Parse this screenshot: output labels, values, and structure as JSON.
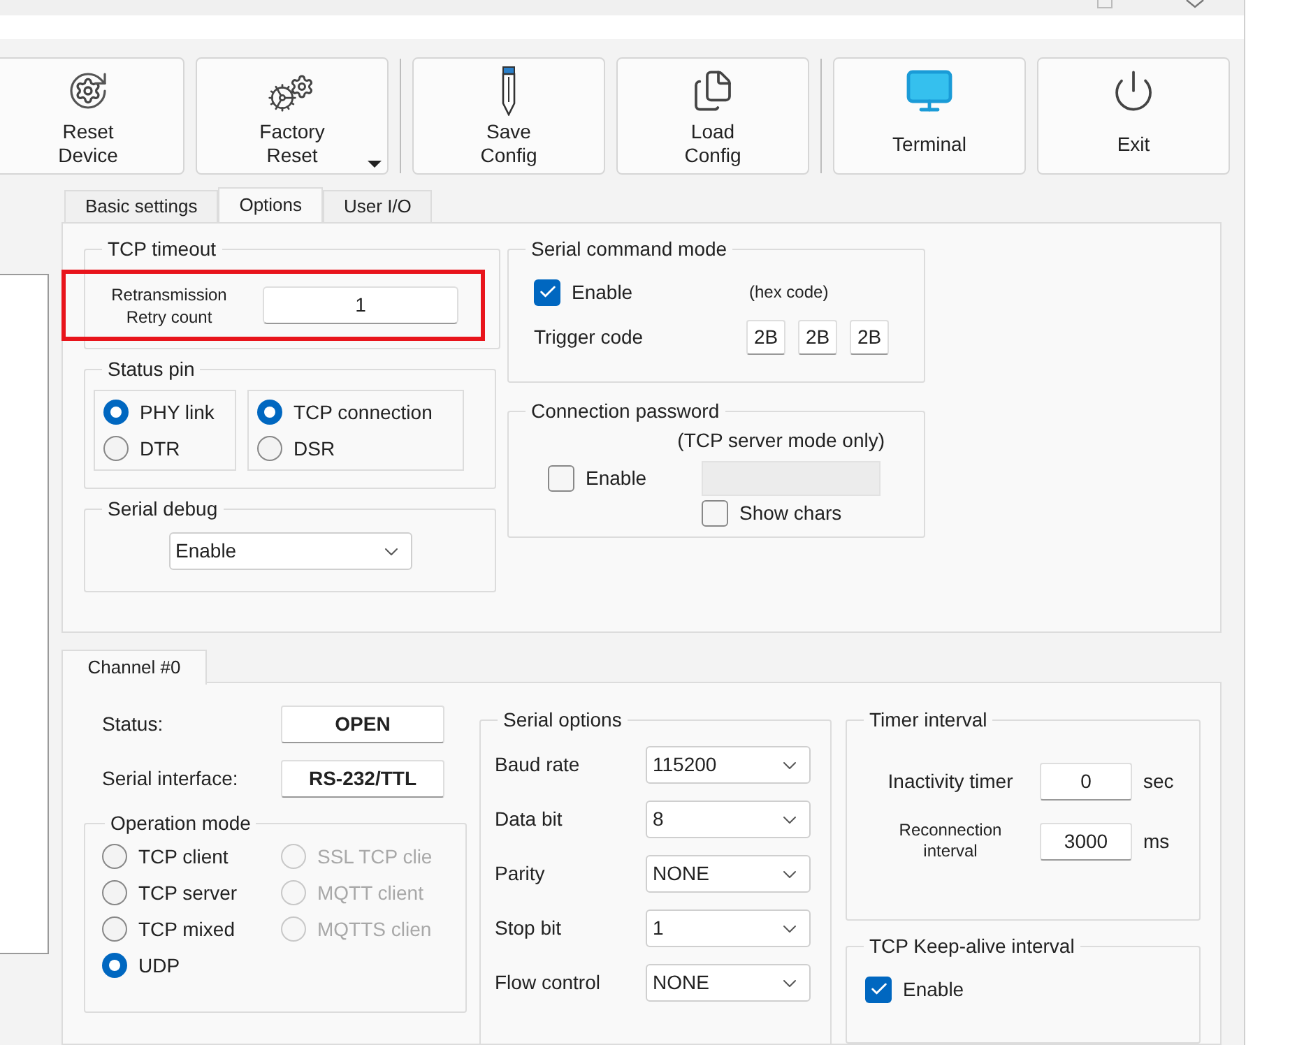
{
  "toolbar": [
    {
      "label": "Reset\nDevice",
      "separator_before": false,
      "dropdown": false
    },
    {
      "label": "Factory\nReset",
      "separator_before": false,
      "dropdown": true
    },
    {
      "label": "Save\nConfig",
      "separator_before": true,
      "dropdown": false
    },
    {
      "label": "Load\nConfig",
      "separator_before": false,
      "dropdown": false
    },
    {
      "label": "Terminal",
      "separator_before": true,
      "dropdown": false
    },
    {
      "label": "Exit",
      "separator_before": false,
      "dropdown": false
    }
  ],
  "tabs": [
    {
      "label": "Basic settings",
      "selected": false
    },
    {
      "label": "Options",
      "selected": true
    },
    {
      "label": "User I/O",
      "selected": false
    }
  ],
  "options": {
    "tcp_timeout": {
      "title": "TCP timeout",
      "label": "Retransmission\nRetry count",
      "value": "1",
      "highlighted": true
    },
    "status_pin": {
      "title": "Status pin",
      "groups": [
        [
          {
            "label": "PHY link",
            "selected": true
          },
          {
            "label": "DTR",
            "selected": false
          }
        ],
        [
          {
            "label": "TCP connection",
            "selected": true
          },
          {
            "label": "DSR",
            "selected": false
          }
        ]
      ]
    },
    "serial_debug": {
      "title": "Serial debug",
      "value": "Enable"
    },
    "serial_command_mode": {
      "title": "Serial command mode",
      "enable": {
        "label": "Enable",
        "checked": true
      },
      "hint": "(hex code)",
      "trigger_label": "Trigger code",
      "trigger_codes": [
        "2B",
        "2B",
        "2B"
      ]
    },
    "connection_password": {
      "title": "Connection password",
      "note": "(TCP server mode only)",
      "enable": {
        "label": "Enable",
        "checked": false
      },
      "show_chars": {
        "label": "Show chars",
        "checked": false
      }
    }
  },
  "channel_tabs": [
    {
      "label": "Channel #0",
      "selected": true
    }
  ],
  "channel": {
    "status": {
      "label": "Status:",
      "value": "OPEN"
    },
    "serial_interface": {
      "label": "Serial interface:",
      "value": "RS-232/TTL"
    },
    "operation_mode": {
      "title": "Operation mode",
      "columns": [
        [
          {
            "label": "TCP client",
            "selected": false,
            "disabled": false
          },
          {
            "label": "TCP server",
            "selected": false,
            "disabled": false
          },
          {
            "label": "TCP mixed",
            "selected": false,
            "disabled": false
          },
          {
            "label": "UDP",
            "selected": true,
            "disabled": false
          }
        ],
        [
          {
            "label": "SSL TCP clie",
            "selected": false,
            "disabled": true
          },
          {
            "label": "MQTT client",
            "selected": false,
            "disabled": true
          },
          {
            "label": "MQTTS clien",
            "selected": false,
            "disabled": true
          }
        ]
      ]
    },
    "serial_options": {
      "title": "Serial options",
      "fields": [
        {
          "label": "Baud rate",
          "value": "115200"
        },
        {
          "label": "Data bit",
          "value": "8"
        },
        {
          "label": "Parity",
          "value": "NONE"
        },
        {
          "label": "Stop bit",
          "value": "1"
        },
        {
          "label": "Flow control",
          "value": "NONE"
        }
      ]
    },
    "timer_interval": {
      "title": "Timer interval",
      "rows": [
        {
          "label": "Inactivity timer",
          "value": "0",
          "unit": "sec",
          "small": false
        },
        {
          "label": "Reconnection\ninterval",
          "value": "3000",
          "unit": "ms",
          "small": true
        }
      ]
    },
    "keep_alive": {
      "title": "TCP Keep-alive interval",
      "enable": {
        "label": "Enable",
        "checked": true
      }
    }
  }
}
